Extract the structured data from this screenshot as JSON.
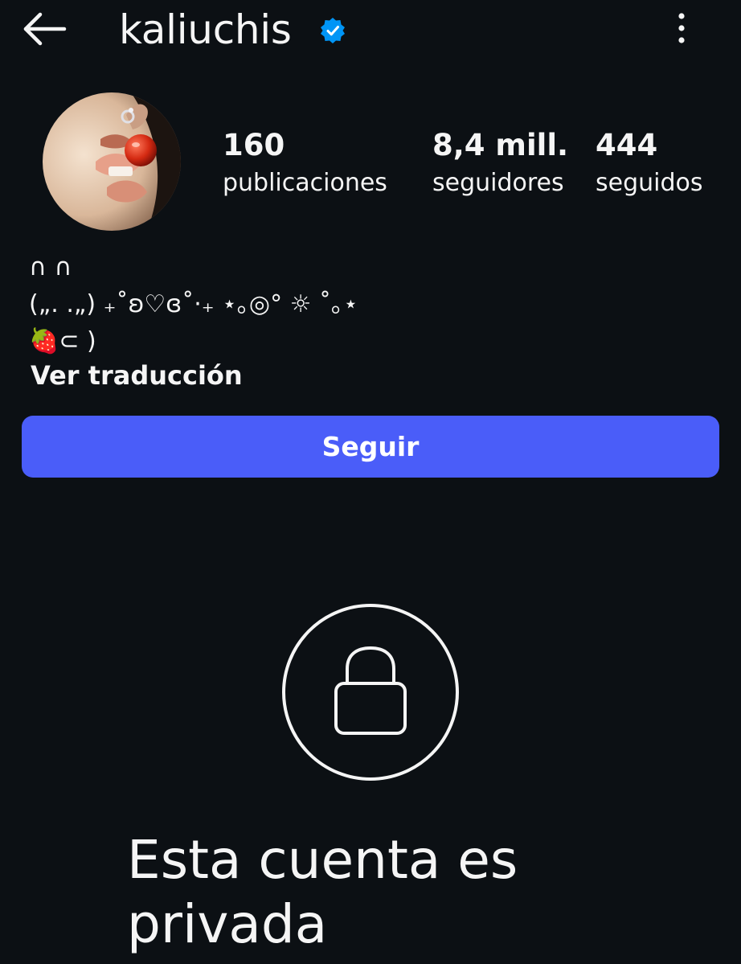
{
  "header": {
    "back_icon": "arrow-left-icon",
    "username": "kaliuchis",
    "verified_icon": "verified-badge-icon",
    "verified_color": "#0095f6",
    "more_icon": "more-vertical-icon"
  },
  "profile": {
    "avatar_icon": "profile-photo",
    "stats": [
      {
        "value": "160",
        "label": "publicaciones"
      },
      {
        "value": "8,4 mill.",
        "label": "seguidores"
      },
      {
        "value": "444",
        "label": "seguidos"
      }
    ],
    "bio": "∩ ∩\n(„. .„) ₊˚ʚ♡ɞ˚·₊ ⋆｡◎° ☼ ˚｡⋆\n🍓⊂ )",
    "translate_label": "Ver traducción"
  },
  "actions": {
    "follow_label": "Seguir",
    "follow_color": "#4a5df9"
  },
  "private_notice": {
    "lock_icon": "lock-icon",
    "text": "Esta cuenta es privada"
  }
}
